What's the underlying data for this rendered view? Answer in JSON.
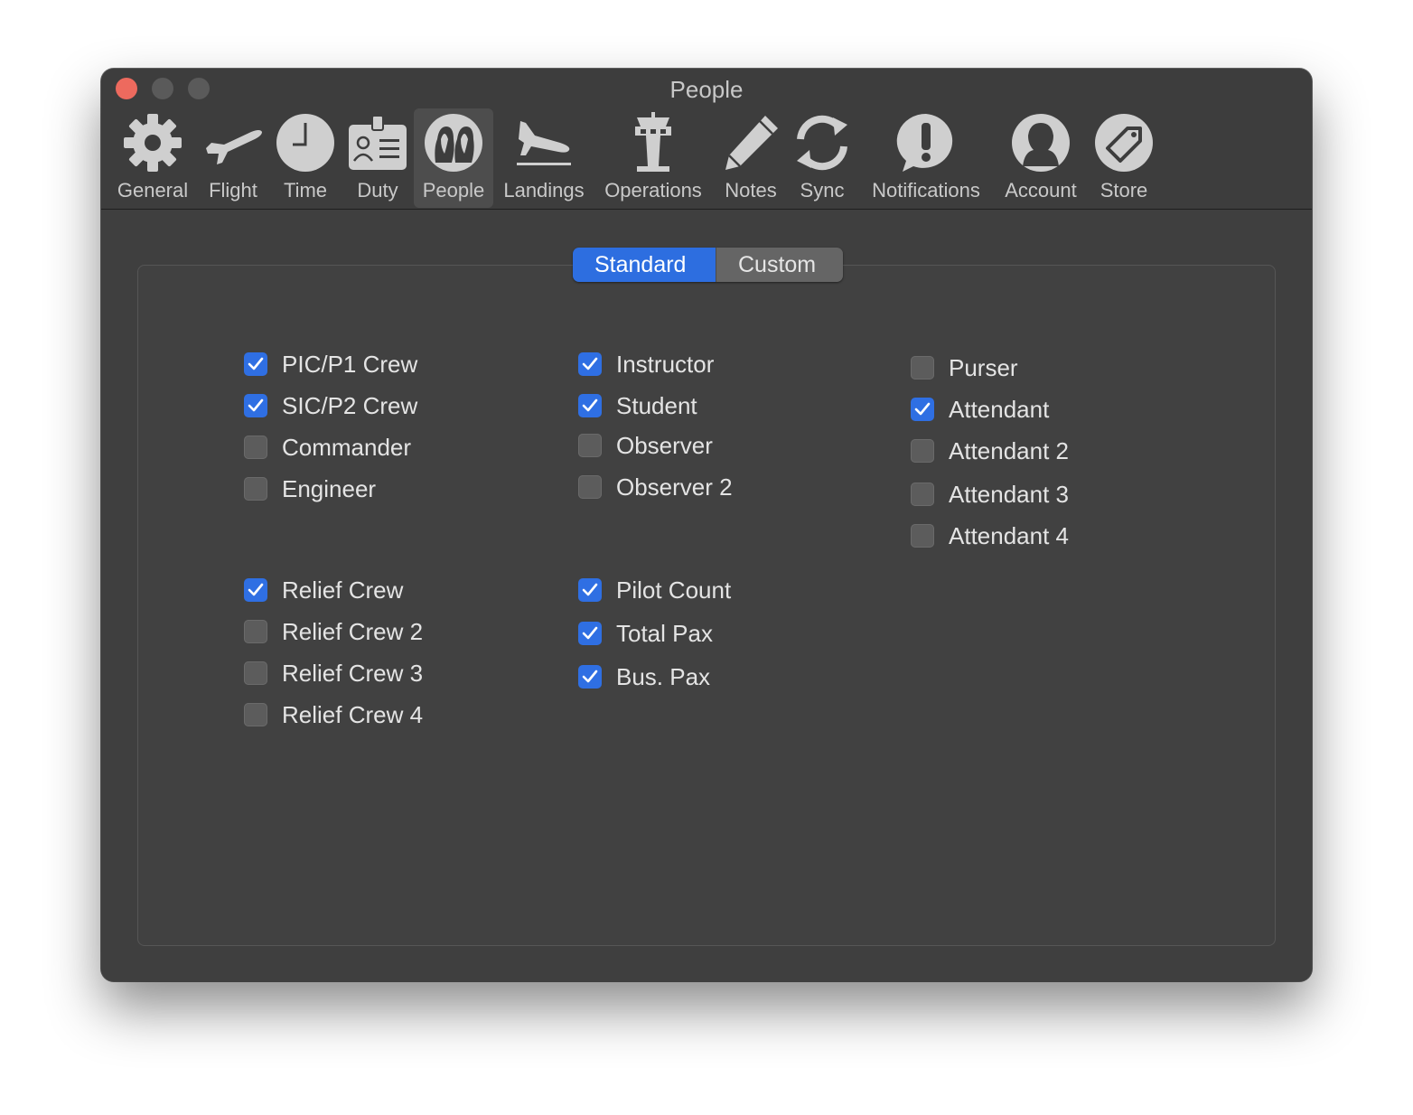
{
  "window": {
    "title": "People"
  },
  "toolbar": {
    "items": [
      {
        "label": "General",
        "icon": "gear-icon"
      },
      {
        "label": "Flight",
        "icon": "airplane-icon"
      },
      {
        "label": "Time",
        "icon": "clock-icon"
      },
      {
        "label": "Duty",
        "icon": "id-badge-icon"
      },
      {
        "label": "People",
        "icon": "people-icon",
        "selected": true
      },
      {
        "label": "Landings",
        "icon": "landing-plane-icon"
      },
      {
        "label": "Operations",
        "icon": "control-tower-icon"
      },
      {
        "label": "Notes",
        "icon": "pencil-icon"
      },
      {
        "label": "Sync",
        "icon": "sync-icon"
      },
      {
        "label": "Notifications",
        "icon": "exclamation-bubble-icon"
      },
      {
        "label": "Account",
        "icon": "person-icon"
      },
      {
        "label": "Store",
        "icon": "tag-icon"
      }
    ]
  },
  "segmented": {
    "standard": "Standard",
    "custom": "Custom",
    "selected": "Standard"
  },
  "columns": {
    "col1a": [
      {
        "label": "PIC/P1 Crew",
        "checked": true
      },
      {
        "label": "SIC/P2 Crew",
        "checked": true
      },
      {
        "label": "Commander",
        "checked": false
      },
      {
        "label": "Engineer",
        "checked": false
      }
    ],
    "col1b": [
      {
        "label": "Relief Crew",
        "checked": true
      },
      {
        "label": "Relief Crew 2",
        "checked": false
      },
      {
        "label": "Relief Crew 3",
        "checked": false
      },
      {
        "label": "Relief Crew 4",
        "checked": false
      }
    ],
    "col2a": [
      {
        "label": "Instructor",
        "checked": true
      },
      {
        "label": "Student",
        "checked": true
      },
      {
        "label": "Observer",
        "checked": false
      },
      {
        "label": "Observer 2",
        "checked": false
      }
    ],
    "col2b": [
      {
        "label": "Pilot Count",
        "checked": true
      },
      {
        "label": "Total Pax",
        "checked": true
      },
      {
        "label": "Bus. Pax",
        "checked": true
      }
    ],
    "col3": [
      {
        "label": "Purser",
        "checked": false
      },
      {
        "label": "Attendant",
        "checked": true
      },
      {
        "label": "Attendant 2",
        "checked": false
      },
      {
        "label": "Attendant 3",
        "checked": false
      },
      {
        "label": "Attendant 4",
        "checked": false
      }
    ]
  },
  "colors": {
    "accent": "#2f6fe3",
    "close": "#ed6a5e"
  }
}
